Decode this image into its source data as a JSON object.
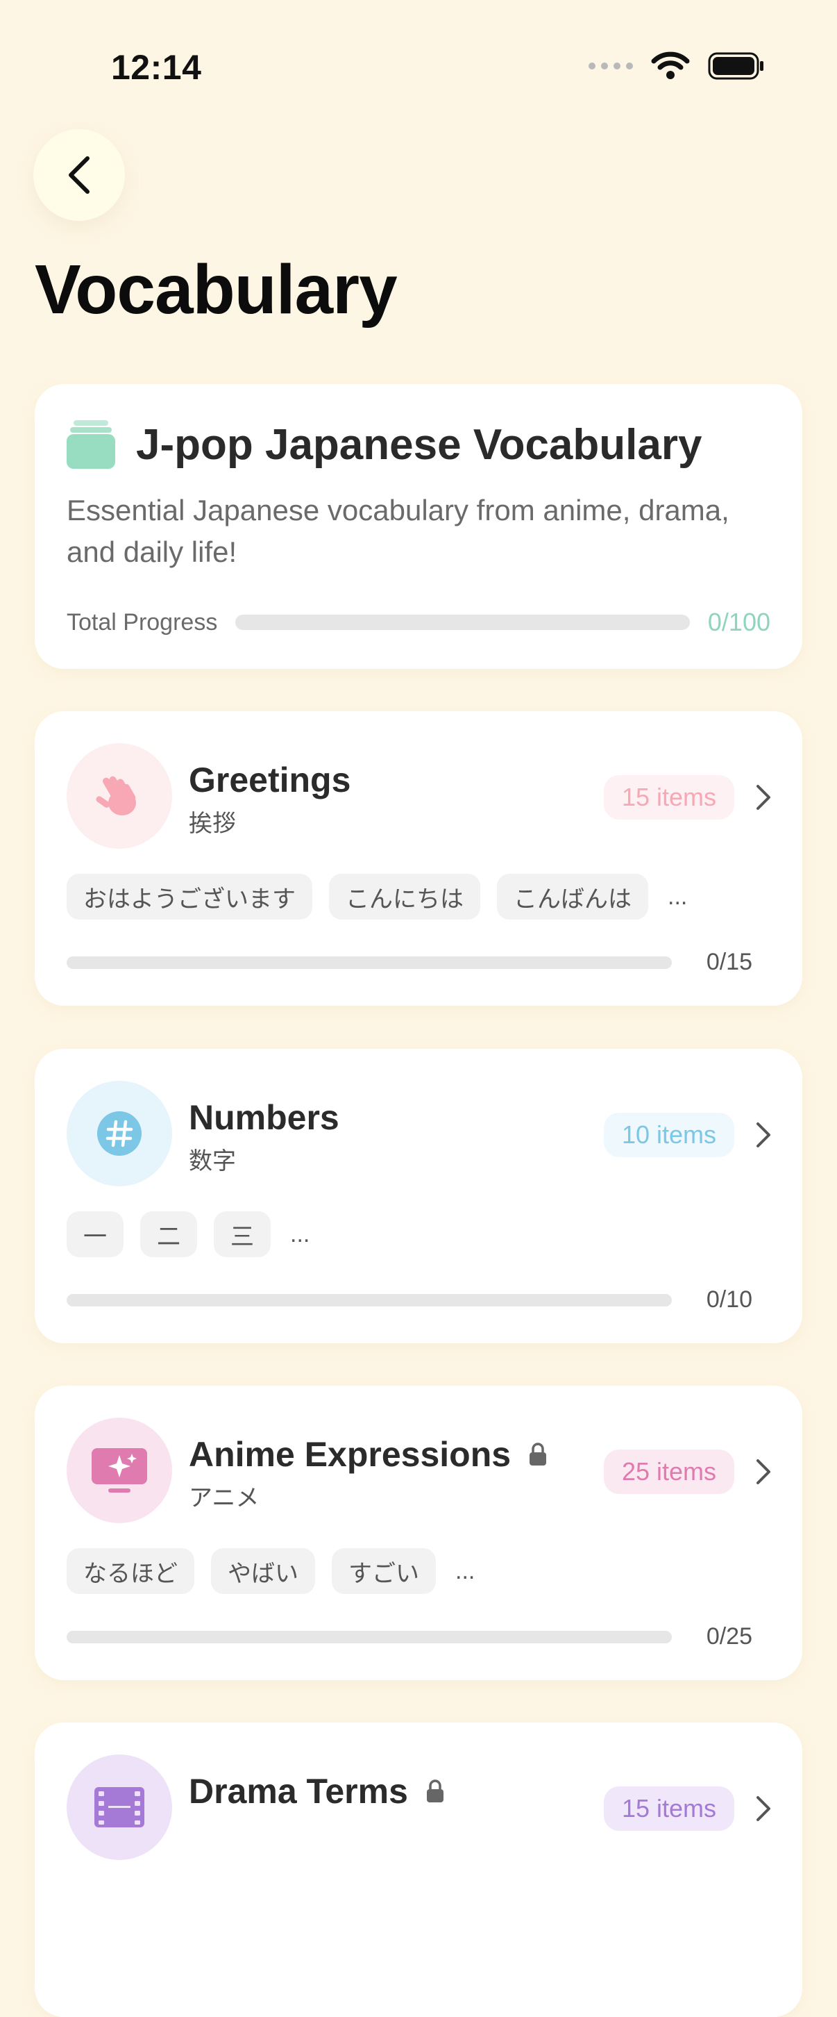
{
  "status": {
    "time": "12:14"
  },
  "header": {
    "title": "Vocabulary"
  },
  "summary": {
    "title": "J-pop Japanese Vocabulary",
    "description": "Essential Japanese vocabulary from anime, drama, and daily life!",
    "progress_label": "Total Progress",
    "progress_count": "0/100",
    "progress_fraction": 0,
    "icon": "stack-icon"
  },
  "categories": [
    {
      "title": "Greetings",
      "subtitle": "挨拶",
      "badge": "15 items",
      "chips": [
        "おはようございます",
        "こんにちは",
        "こんばんは"
      ],
      "more": "...",
      "count": "0/15",
      "progress_fraction": 0,
      "locked": false,
      "icon": "waving-hand-icon",
      "accent": "#F7A8B4",
      "icon_bg": "#FDEEF0",
      "badge_bg": "#FEF1F3"
    },
    {
      "title": "Numbers",
      "subtitle": "数字",
      "badge": "10 items",
      "chips": [
        "一",
        "二",
        "三"
      ],
      "more": "...",
      "count": "0/10",
      "progress_fraction": 0,
      "locked": false,
      "icon": "hashtag-icon",
      "accent": "#7CC6E6",
      "icon_bg": "#E6F4FB",
      "badge_bg": "#EEF8FD"
    },
    {
      "title": "Anime Expressions",
      "subtitle": "アニメ",
      "badge": "25 items",
      "chips": [
        "なるほど",
        "やばい",
        "すごい"
      ],
      "more": "...",
      "count": "0/25",
      "progress_fraction": 0,
      "locked": true,
      "icon": "tv-sparkle-icon",
      "accent": "#E07BB0",
      "icon_bg": "#F9E3EF",
      "badge_bg": "#FBE9F2"
    },
    {
      "title": "Drama Terms",
      "subtitle": "",
      "badge": "15 items",
      "chips": [],
      "more": "",
      "count": "",
      "progress_fraction": 0,
      "locked": true,
      "icon": "film-icon",
      "accent": "#A57AD6",
      "icon_bg": "#EEE2F8",
      "badge_bg": "#F1E7FA"
    }
  ]
}
